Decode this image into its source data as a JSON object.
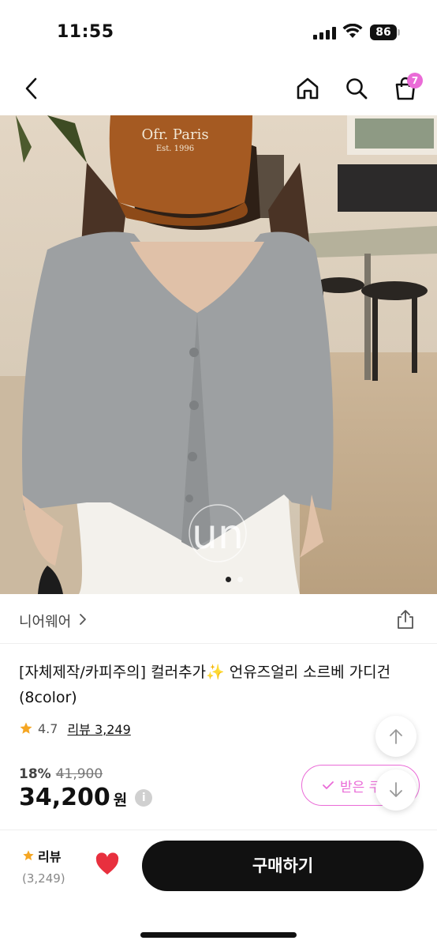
{
  "status_bar": {
    "time": "11:55",
    "battery": "86"
  },
  "nav": {
    "back_icon": "chevron-left-icon",
    "home_icon": "home-icon",
    "search_icon": "search-icon",
    "cart_icon": "shopping-bag-icon",
    "cart_count": "7"
  },
  "hero": {
    "cap_text_line1": "Ofr. Paris",
    "cap_text_line2": "Est. 1996",
    "watermark": "un",
    "dots_count": 2,
    "active_dot": 1
  },
  "brand": {
    "name": "니어웨어",
    "chevron": "›"
  },
  "product": {
    "title": "[자체제작/카피주의] 컬러추가✨ 언유즈얼리 소르베 가디건 (8color)",
    "rating": "4.7",
    "review_link": "리뷰 3,249",
    "discount_rate": "18%",
    "original_price": "41,900",
    "price": "34,200",
    "price_unit": "원",
    "info": "i"
  },
  "coupon": {
    "label": "받은 쿠"
  },
  "bottom_bar": {
    "review_label": "리뷰",
    "review_count": "(3,249)",
    "buy_label": "구매하기"
  },
  "colors": {
    "accent": "#ea6bd7",
    "star": "#f5a623",
    "heart": "#e8303e"
  }
}
